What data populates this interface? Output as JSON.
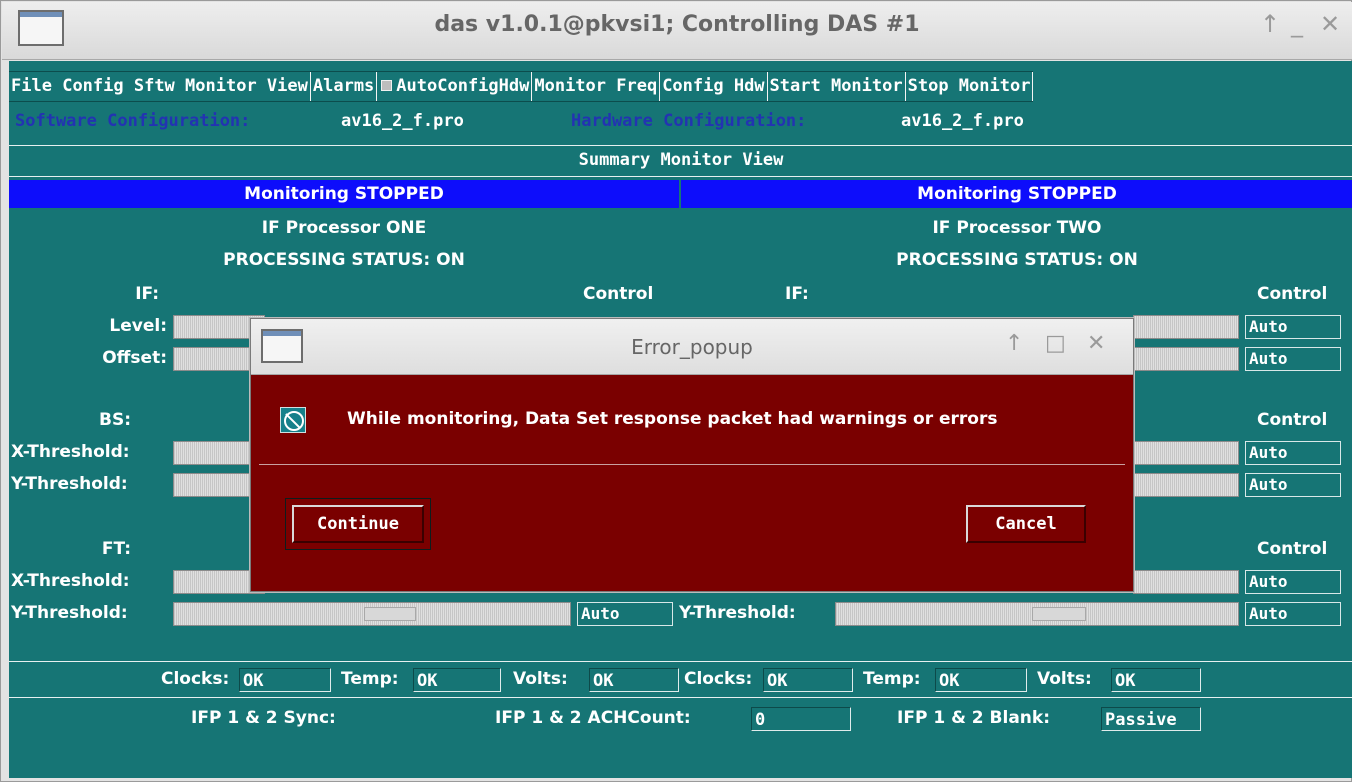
{
  "window": {
    "title": "das v1.0.1@pkvsi1;  Controlling DAS #1",
    "controls": [
      "↑",
      "_",
      "✕"
    ]
  },
  "menu": {
    "items": [
      "File",
      "Config Sftw",
      "Monitor View",
      "Alarms",
      "AutoConfigHdw",
      "Monitor Freq",
      "Config Hdw",
      "Start Monitor",
      "Stop Monitor"
    ],
    "autoconfig_checked": true
  },
  "config": {
    "software_label": "Software Configuration:",
    "software_value": "av16_2_f.pro",
    "hardware_label": "Hardware Configuration:",
    "hardware_value": "av16_2_f.pro"
  },
  "view_title": "Summary Monitor View",
  "left": {
    "monitoring": "Monitoring STOPPED",
    "processor": "IF Processor ONE",
    "status": "PROCESSING STATUS: ON",
    "if_label": "IF:",
    "control_header": "Control",
    "level_label": "Level:",
    "offset_label": "Offset:",
    "bs_label": "BS:",
    "xthr_label": "X-Threshold:",
    "ythr_label": "Y-Threshold:",
    "ft_label": "FT:",
    "ft_xthr_label": "X-Threshold:",
    "ft_ythr_label": "Y-Threshold:",
    "ft_y_control": "Auto"
  },
  "right": {
    "monitoring": "Monitoring STOPPED",
    "processor": "IF Processor TWO",
    "status": "PROCESSING STATUS: ON",
    "if_label": "IF:",
    "control_if": "Control",
    "control_bs": "Control",
    "control_ft": "Control",
    "ft_ythr_label": "Y-Threshold:",
    "controls": [
      "Auto",
      "Auto",
      "Auto",
      "Auto",
      "Auto",
      "Auto"
    ]
  },
  "status_row": {
    "clocks_label": "Clocks:",
    "clocks_value": "OK",
    "temp_label": "Temp:",
    "temp_value": "OK",
    "volts_label": "Volts:",
    "volts_value": "OK",
    "clocks2_label": "Clocks:",
    "clocks2_value": "OK",
    "temp2_label": "Temp:",
    "temp2_value": "OK",
    "volts2_label": "Volts:",
    "volts2_value": "OK"
  },
  "ifp_row": {
    "sync_label": "IFP 1 & 2   Sync:",
    "ach_label": "IFP 1 & 2   ACHCount:",
    "ach_value": "0",
    "blank_label": "IFP 1 & 2   Blank:",
    "blank_value": "Passive"
  },
  "dialog": {
    "title": "Error_popup",
    "controls": [
      "↑",
      "□",
      "✕"
    ],
    "message": "While monitoring, Data Set response packet had warnings or errors",
    "continue_label": "Continue",
    "cancel_label": "Cancel"
  }
}
